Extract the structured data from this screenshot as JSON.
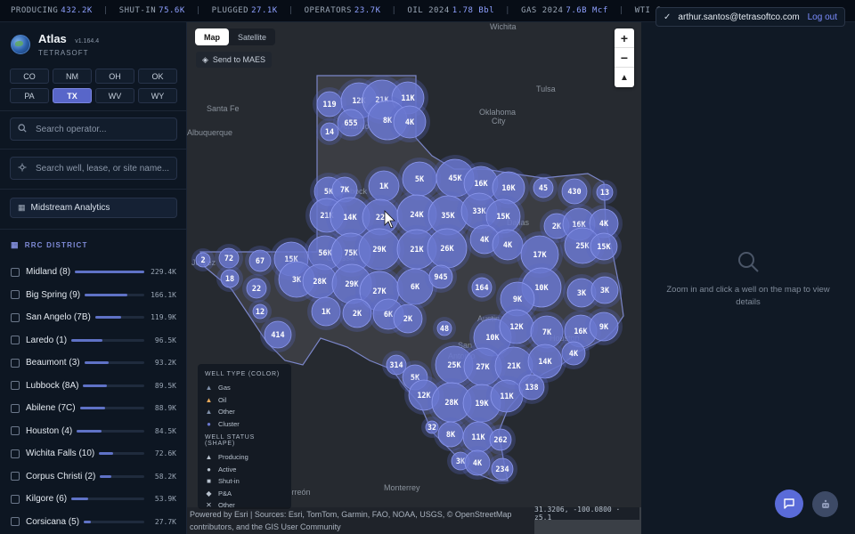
{
  "ticker": [
    {
      "label": "PRODUCING",
      "value": "432.2K"
    },
    {
      "label": "SHUT-IN",
      "value": "75.6K"
    },
    {
      "label": "PLUGGED",
      "value": "27.1K"
    },
    {
      "label": "OPERATORS",
      "value": "23.7K"
    },
    {
      "label": "OIL 2024",
      "value": "1.78 Bbl"
    },
    {
      "label": "GAS 2024",
      "value": "7.6B Mcf"
    },
    {
      "label": "WTI C",
      "value": ""
    }
  ],
  "account": {
    "email": "arthur.santos@tetrasoftco.com",
    "logout": "Log out",
    "check": "✓"
  },
  "brand": {
    "name": "Atlas",
    "version": "v1.164.4",
    "company": "TETRASOFT"
  },
  "states": [
    {
      "code": "CO",
      "active": false
    },
    {
      "code": "NM",
      "active": false
    },
    {
      "code": "OH",
      "active": false
    },
    {
      "code": "OK",
      "active": false
    },
    {
      "code": "PA",
      "active": false
    },
    {
      "code": "TX",
      "active": true
    },
    {
      "code": "WV",
      "active": false
    },
    {
      "code": "WY",
      "active": false
    }
  ],
  "search": {
    "operator_placeholder": "Search operator...",
    "well_placeholder": "Search well, lease, or site name..."
  },
  "midstream": {
    "label": "Midstream Analytics"
  },
  "rrc": {
    "heading": "RRC DISTRICT",
    "districts": [
      {
        "name": "Midland (8)",
        "value": "229.4K",
        "share": 1.0
      },
      {
        "name": "Big Spring (9)",
        "value": "166.1K",
        "share": 0.72
      },
      {
        "name": "San Angelo (7B)",
        "value": "119.9K",
        "share": 0.52
      },
      {
        "name": "Laredo (1)",
        "value": "96.5K",
        "share": 0.42
      },
      {
        "name": "Beaumont (3)",
        "value": "93.2K",
        "share": 0.41
      },
      {
        "name": "Lubbock (8A)",
        "value": "89.5K",
        "share": 0.39
      },
      {
        "name": "Abilene (7C)",
        "value": "88.9K",
        "share": 0.39
      },
      {
        "name": "Houston (4)",
        "value": "84.5K",
        "share": 0.37
      },
      {
        "name": "Wichita Falls (10)",
        "value": "72.6K",
        "share": 0.32
      },
      {
        "name": "Corpus Christi (2)",
        "value": "58.2K",
        "share": 0.25
      },
      {
        "name": "Kilgore (6)",
        "value": "53.9K",
        "share": 0.23
      },
      {
        "name": "Corsicana (5)",
        "value": "27.7K",
        "share": 0.12
      }
    ]
  },
  "map": {
    "toggle": {
      "map": "Map",
      "satellite": "Satellite"
    },
    "send_label": "Send to MAES",
    "zoom_in": "+",
    "zoom_out": "−",
    "compass": "▲",
    "place_labels": [
      {
        "text": "Wichita"
      },
      {
        "text": "Tulsa"
      },
      {
        "text": "Santa Fe"
      },
      {
        "text": "Oklahoma"
      },
      {
        "text": "City"
      },
      {
        "text": "Albuquerque"
      },
      {
        "text": "Amarillo"
      },
      {
        "text": "Lubbock"
      },
      {
        "text": "Dallas"
      },
      {
        "text": "Juárez"
      },
      {
        "text": "Odessa"
      },
      {
        "text": "Austin"
      },
      {
        "text": "San"
      },
      {
        "text": "Antonio"
      },
      {
        "text": "Houston"
      },
      {
        "text": "Torreón"
      },
      {
        "text": "Monterrey"
      }
    ],
    "clusters": [
      {
        "label": "119"
      },
      {
        "label": "12K"
      },
      {
        "label": "21K"
      },
      {
        "label": "11K"
      },
      {
        "label": "655"
      },
      {
        "label": "8K"
      },
      {
        "label": "4K"
      },
      {
        "label": "14"
      },
      {
        "label": "5K"
      },
      {
        "label": "7K"
      },
      {
        "label": "1K"
      },
      {
        "label": "5K"
      },
      {
        "label": "45K"
      },
      {
        "label": "16K"
      },
      {
        "label": "10K"
      },
      {
        "label": "45"
      },
      {
        "label": "430"
      },
      {
        "label": "13"
      },
      {
        "label": "21K"
      },
      {
        "label": "14K"
      },
      {
        "label": "22"
      },
      {
        "label": "24K"
      },
      {
        "label": "35K"
      },
      {
        "label": "33K"
      },
      {
        "label": "15K"
      },
      {
        "label": "2K"
      },
      {
        "label": "16K"
      },
      {
        "label": "4K"
      },
      {
        "label": "56K"
      },
      {
        "label": "75K"
      },
      {
        "label": "29K"
      },
      {
        "label": "21K"
      },
      {
        "label": "26K"
      },
      {
        "label": "4K"
      },
      {
        "label": "4K"
      },
      {
        "label": "17K"
      },
      {
        "label": "25K"
      },
      {
        "label": "15K"
      },
      {
        "label": "2"
      },
      {
        "label": "72"
      },
      {
        "label": "67"
      },
      {
        "label": "15K"
      },
      {
        "label": "18"
      },
      {
        "label": "3K"
      },
      {
        "label": "28K"
      },
      {
        "label": "29K"
      },
      {
        "label": "27K"
      },
      {
        "label": "6K"
      },
      {
        "label": "945"
      },
      {
        "label": "164"
      },
      {
        "label": "10K"
      },
      {
        "label": "3K"
      },
      {
        "label": "3K"
      },
      {
        "label": "22"
      },
      {
        "label": "12"
      },
      {
        "label": "1K"
      },
      {
        "label": "2K"
      },
      {
        "label": "6K"
      },
      {
        "label": "2K"
      },
      {
        "label": "9K"
      },
      {
        "label": "414"
      },
      {
        "label": "48"
      },
      {
        "label": "10K"
      },
      {
        "label": "12K"
      },
      {
        "label": "7K"
      },
      {
        "label": "16K"
      },
      {
        "label": "9K"
      },
      {
        "label": "4K"
      },
      {
        "label": "314"
      },
      {
        "label": "5K"
      },
      {
        "label": "25K"
      },
      {
        "label": "27K"
      },
      {
        "label": "21K"
      },
      {
        "label": "14K"
      },
      {
        "label": "12K"
      },
      {
        "label": "28K"
      },
      {
        "label": "19K"
      },
      {
        "label": "11K"
      },
      {
        "label": "138"
      },
      {
        "label": "32"
      },
      {
        "label": "8K"
      },
      {
        "label": "11K"
      },
      {
        "label": "262"
      },
      {
        "label": "3K"
      },
      {
        "label": "4K"
      },
      {
        "label": "234"
      }
    ],
    "legend": {
      "type_heading": "WELL TYPE (COLOR)",
      "types": [
        {
          "label": "Gas",
          "color": "#7f8fa8",
          "symbol": "▲"
        },
        {
          "label": "Oil",
          "color": "#e8a95a",
          "symbol": "▲"
        },
        {
          "label": "Other",
          "color": "#7f8fa8",
          "symbol": "▲"
        },
        {
          "label": "Cluster",
          "color": "#6a78d0",
          "symbol": "●"
        }
      ],
      "status_heading": "WELL STATUS (SHAPE)",
      "statuses": [
        {
          "label": "Producing",
          "symbol": "▲"
        },
        {
          "label": "Active",
          "symbol": "●"
        },
        {
          "label": "Shut-in",
          "symbol": "■"
        },
        {
          "label": "P&A",
          "symbol": "◆"
        },
        {
          "label": "Other",
          "symbol": "✕"
        }
      ]
    },
    "attribution": "Powered by Esri | Sources: Esri, TomTom, Garmin, FAO, NOAA, USGS, © OpenStreetMap contributors, and the GIS User Community",
    "coords": "31.3206, -100.0800 · z5.1"
  },
  "details": {
    "empty_text": "Zoom in and click a well on the map to view details"
  },
  "colors": {
    "accent": "#5866c9",
    "cluster": "#6a78d0",
    "link": "#7b8dff"
  }
}
